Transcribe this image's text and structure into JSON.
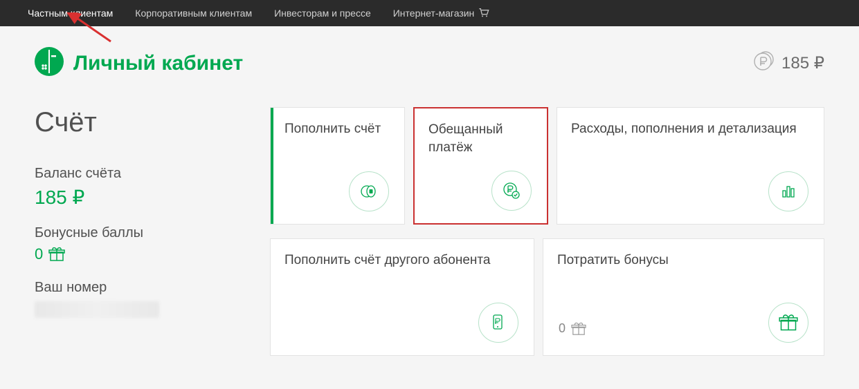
{
  "topnav": {
    "items": [
      "Частным клиентам",
      "Корпоративным клиентам",
      "Инвесторам и прессе",
      "Интернет-магазин"
    ]
  },
  "header": {
    "title": "Личный кабинет",
    "balance": "185 ₽"
  },
  "sidebar": {
    "section_title": "Счёт",
    "balance_label": "Баланс счёта",
    "balance_value": "185 ₽",
    "bonus_label": "Бонусные баллы",
    "bonus_value": "0",
    "phone_label": "Ваш номер"
  },
  "cards": {
    "topup": "Пополнить счёт",
    "promised": "Обещанный платёж",
    "expenses": "Расходы, пополнения и детализация",
    "topup_other": "Пополнить счёт другого абонента",
    "spend_bonus": "Потратить бонусы",
    "spend_bonus_value": "0"
  }
}
